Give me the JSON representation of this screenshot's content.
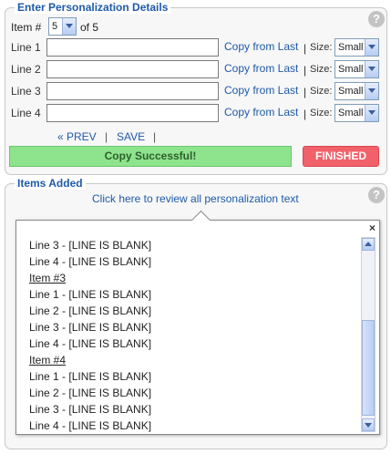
{
  "details": {
    "legend": "Enter Personalization Details",
    "item_label": "Item #",
    "item_value": "5",
    "of_label": "of 5",
    "lines": [
      {
        "label": "Line 1",
        "value": "",
        "copy_link": "Copy from Last",
        "size_label": "Size:",
        "size_value": "Small"
      },
      {
        "label": "Line 2",
        "value": "",
        "copy_link": "Copy from Last",
        "size_label": "Size:",
        "size_value": "Small"
      },
      {
        "label": "Line 3",
        "value": "",
        "copy_link": "Copy from Last",
        "size_label": "Size:",
        "size_value": "Small"
      },
      {
        "label": "Line 4",
        "value": "",
        "copy_link": "Copy from Last",
        "size_label": "Size:",
        "size_value": "Small"
      }
    ],
    "nav": {
      "prev": "« PREV",
      "sep": "|",
      "save": "SAVE"
    },
    "status_message": "Copy Successful!",
    "finished_label": "FINISHED",
    "help": "?"
  },
  "items_added": {
    "legend": "Items Added",
    "review_link": "Click here to review all personalization text",
    "help": "?"
  },
  "popup": {
    "close": "×",
    "lines": [
      {
        "text": "Line 3 - [LINE IS BLANK]",
        "heading": false
      },
      {
        "text": "Line 4 - [LINE IS BLANK]",
        "heading": false
      },
      {
        "text": "Item #3",
        "heading": true
      },
      {
        "text": "Line 1 - [LINE IS BLANK]",
        "heading": false
      },
      {
        "text": "Line 2 - [LINE IS BLANK]",
        "heading": false
      },
      {
        "text": "Line 3 - [LINE IS BLANK]",
        "heading": false
      },
      {
        "text": "Line 4 - [LINE IS BLANK]",
        "heading": false
      },
      {
        "text": "Item #4",
        "heading": true
      },
      {
        "text": "Line 1 - [LINE IS BLANK]",
        "heading": false
      },
      {
        "text": "Line 2 - [LINE IS BLANK]",
        "heading": false
      },
      {
        "text": "Line 3 - [LINE IS BLANK]",
        "heading": false
      },
      {
        "text": "Line 4 - [LINE IS BLANK]",
        "heading": false
      }
    ]
  },
  "colors": {
    "accent": "#1e5aa8",
    "success": "#8ee48c",
    "finished": "#f0616a"
  }
}
